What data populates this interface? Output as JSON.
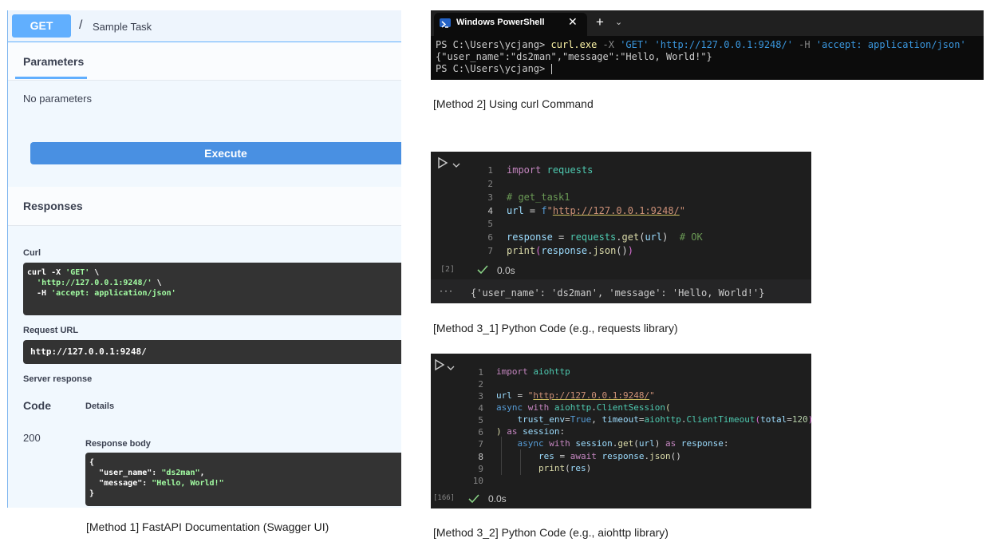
{
  "swagger": {
    "method": "GET",
    "slash": "/",
    "summary": "Sample Task",
    "parameters_title": "Parameters",
    "no_parameters": "No parameters",
    "execute_label": "Execute",
    "responses_title": "Responses",
    "curl_label": "Curl",
    "curl_lines": [
      "curl -X ",
      "'GET'",
      " \\",
      "  ",
      "'http://127.0.0.1:9248/'",
      " \\",
      "  -H ",
      "'accept: application/json'"
    ],
    "request_url_label": "Request URL",
    "request_url": "http://127.0.0.1:9248/",
    "server_response_label": "Server response",
    "code_header": "Code",
    "details_header": "Details",
    "code_value": "200",
    "response_body_label": "Response body",
    "body_open": "{",
    "body_key1": "\"user_name\"",
    "body_val1": "\"ds2man\"",
    "body_key2": "\"message\"",
    "body_val2": "\"Hello, World!\"",
    "body_close": "}"
  },
  "powershell": {
    "tab_title": "Windows PowerShell",
    "close_glyph": "✕",
    "plus_glyph": "+",
    "chevron_glyph": "⌄",
    "prompt": "PS C:\\Users\\ycjang> ",
    "cmd": "curl.exe",
    "flag_x": " -X ",
    "method_str": "'GET'",
    "url_str": " 'http://127.0.0.1:9248/'",
    "flag_h": " -H ",
    "header_str": "'accept: application/json'",
    "output": "{\"user_name\":\"ds2man\",\"message\":\"Hello, World!\"}",
    "prompt2": "PS C:\\Users\\ycjang> "
  },
  "cell1": {
    "exec_count": "[2]",
    "time": "0.0s",
    "output": "{'user_name': 'ds2man', 'message': 'Hello, World!'}",
    "ellipsis": "···"
  },
  "cell2": {
    "exec_count": "[166]",
    "time": "0.0s"
  },
  "captions": {
    "method1": "[Method 1] FastAPI Documentation (Swagger UI)",
    "method2": "[Method 2] Using curl Command",
    "method3_1": "[Method 3_1] Python Code (e.g., requests library)",
    "method3_2": "[Method 3_2] Python Code (e.g., aiohttp library)"
  },
  "colors": {
    "get_badge": "#61affe",
    "execute": "#4990e2",
    "swagger_bg": "#f1f8fe",
    "terminal_bg": "#0c0c0c",
    "cell_bg": "#1e1e1e"
  }
}
